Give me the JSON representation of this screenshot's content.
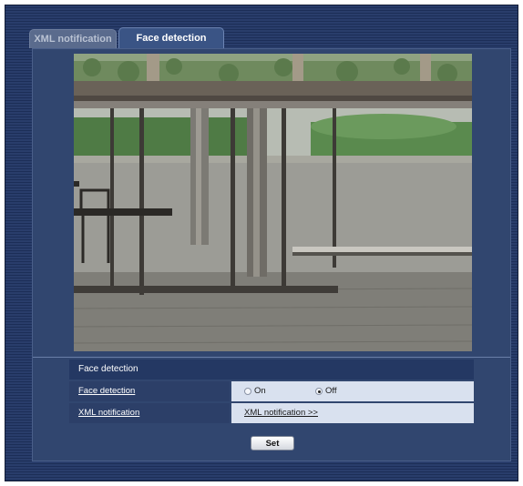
{
  "tabs": [
    {
      "label": "XML notification",
      "active": false
    },
    {
      "label": "Face detection",
      "active": true
    }
  ],
  "camera_view": {
    "icon": "camera-live-image"
  },
  "section": {
    "title": "Face detection"
  },
  "rows": {
    "face_detection": {
      "label": "Face detection",
      "options": [
        {
          "label": "On",
          "selected": false
        },
        {
          "label": "Off",
          "selected": true
        }
      ]
    },
    "xml_notification": {
      "label": "XML notification",
      "link": "XML notification >>"
    }
  },
  "set_button": "Set",
  "colors": {
    "background": "#293d6b",
    "panel": "#31466f",
    "row_label_bg": "#2c3f68",
    "row_value_bg": "#d9e1ef",
    "active_tab": "#3a5485"
  }
}
